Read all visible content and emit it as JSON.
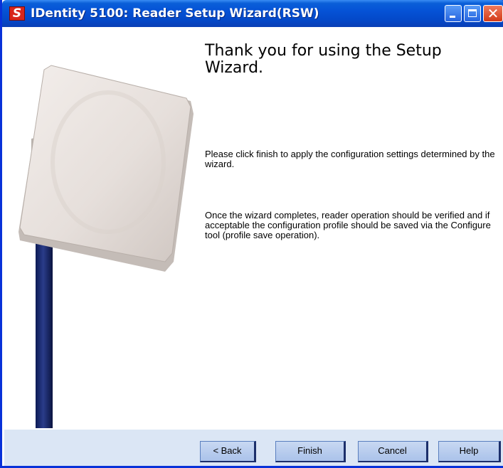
{
  "window": {
    "title": "IDentity 5100: Reader Setup Wizard(RSW)",
    "app_icon_letter": "S",
    "close_glyph": "✕"
  },
  "main": {
    "heading": "Thank you for using the Setup Wizard.",
    "paragraphs": [
      "Please click finish to apply the configuration settings determined by the wizard.",
      "Once the wizard completes, reader operation should be verified and if acceptable the configuration profile should be saved via the Configure tool (profile save operation)."
    ]
  },
  "buttons": {
    "back": "< Back",
    "finish": "Finish",
    "cancel": "Cancel",
    "help": "Help"
  },
  "colors": {
    "titlebar": "#0552d6",
    "footer": "#dbe6f5",
    "button": "#b4c8ee",
    "app_icon": "#d8261c"
  }
}
